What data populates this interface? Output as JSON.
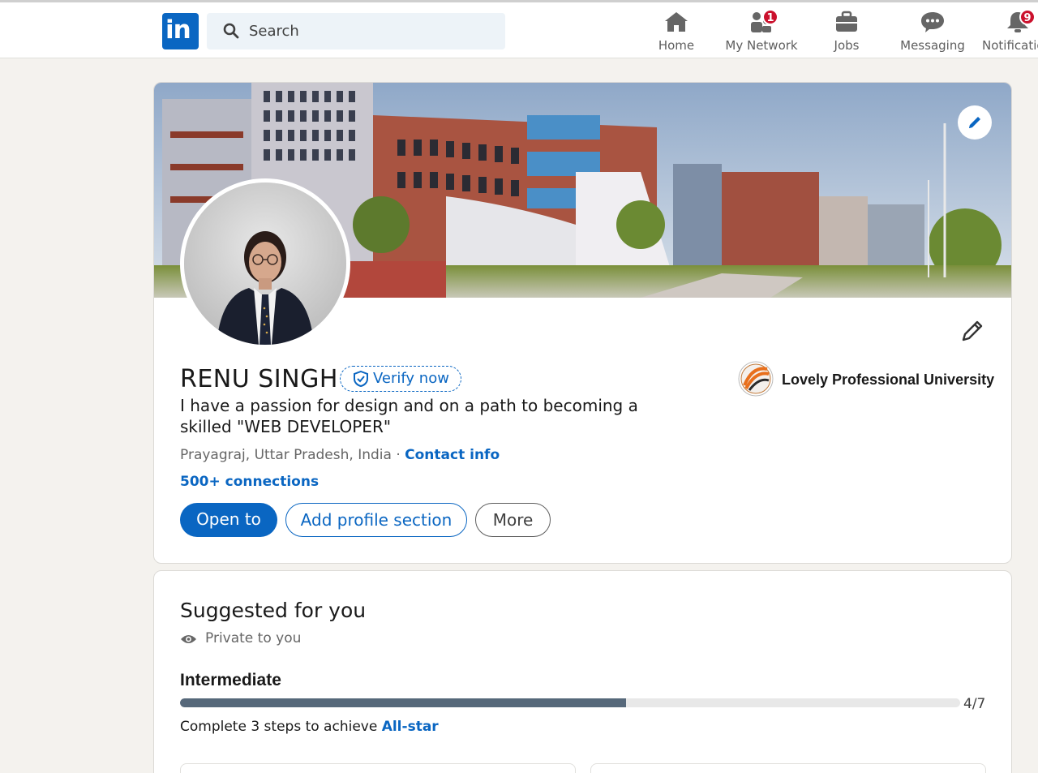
{
  "nav": {
    "search_placeholder": "Search",
    "items": [
      {
        "label": "Home",
        "icon": "home-icon",
        "badge": ""
      },
      {
        "label": "My Network",
        "icon": "network-icon",
        "badge": "1"
      },
      {
        "label": "Jobs",
        "icon": "briefcase-icon",
        "badge": ""
      },
      {
        "label": "Messaging",
        "icon": "messaging-icon",
        "badge": ""
      },
      {
        "label": "Notifications",
        "icon": "bell-icon",
        "badge": "9"
      }
    ]
  },
  "profile": {
    "name": "RENU SINGH",
    "verify_label": "Verify now",
    "headline": "I have a passion for design and on a path to becoming a skilled \"WEB DEVELOPER\"",
    "location": "Prayagraj, Uttar Pradesh, India",
    "separator": "·",
    "contact_label": "Contact info",
    "connections": "500+ connections",
    "buttons": {
      "open_to": "Open to",
      "add_section": "Add profile section",
      "more": "More"
    },
    "school": "Lovely Professional University"
  },
  "suggested": {
    "title": "Suggested for you",
    "privacy": "Private to you",
    "level": "Intermediate",
    "progress": {
      "completed": 4,
      "total": 7,
      "label": "4/7"
    },
    "achieve_prefix": "Complete 3 steps to achieve",
    "achieve_link": "All-star"
  },
  "colors": {
    "brand": "#0a66c2",
    "badge": "#cb112d",
    "progress_fill": "#56687a"
  }
}
